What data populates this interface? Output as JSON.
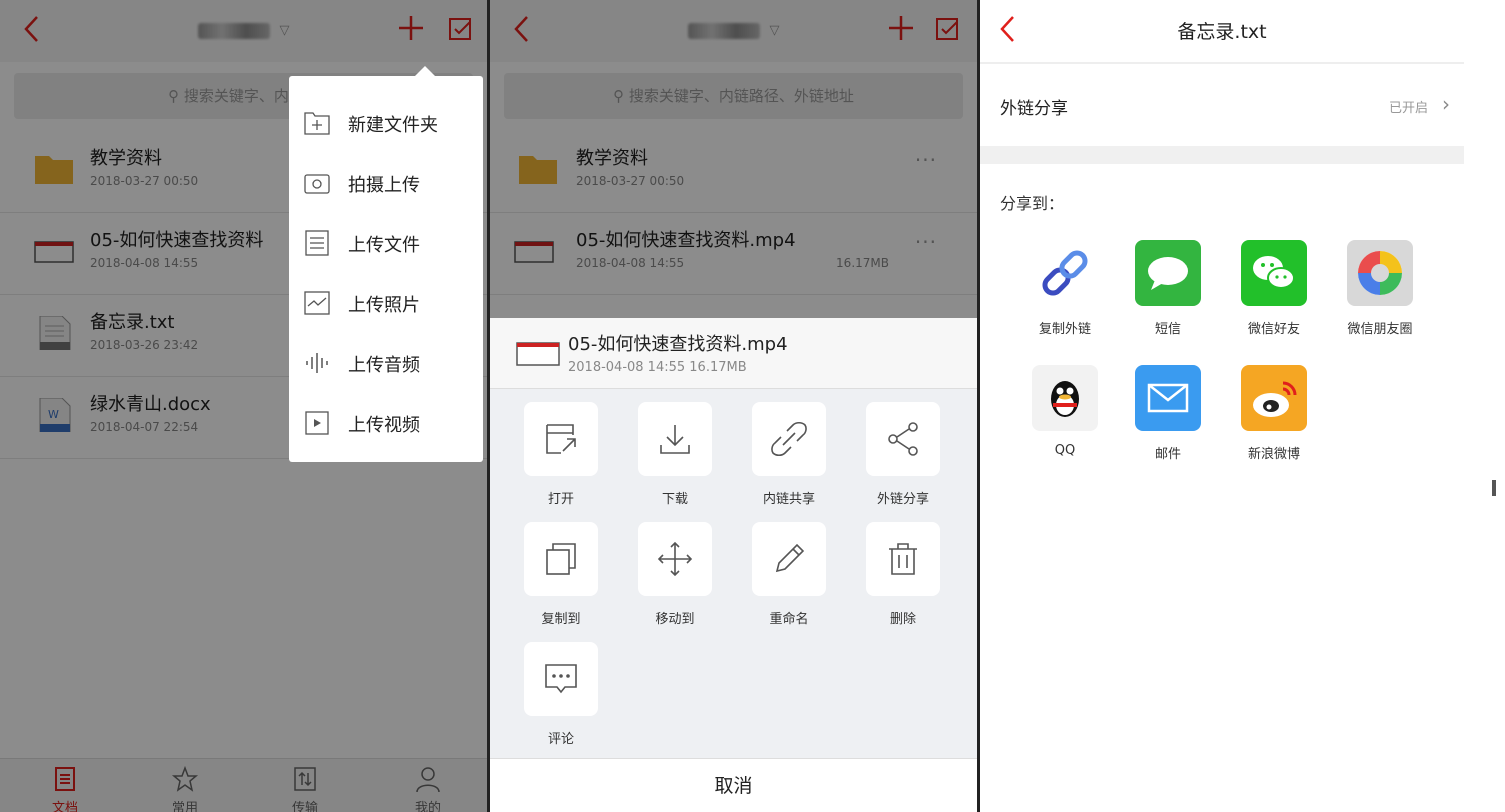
{
  "colors": {
    "accent": "#e0201c",
    "folder": "#f2b636",
    "wechat": "#22c02a",
    "sms": "#33b540",
    "mail": "#3a9bf0"
  },
  "panel1": {
    "search_placeholder": "搜索关键字、内链路",
    "files": [
      {
        "name": "教学资料",
        "meta": "2018-03-27 00:50",
        "icon": "folder-icon"
      },
      {
        "name": "05-如何快速查找资料",
        "meta": "2018-04-08 14:55",
        "icon": "video-file-icon"
      },
      {
        "name": "备忘录.txt",
        "meta": "2018-03-26 23:42",
        "icon": "txt-file-icon"
      },
      {
        "name": "绿水青山.docx",
        "meta": "2018-04-07 22:54",
        "icon": "word-file-icon"
      }
    ],
    "menu": [
      {
        "label": "新建文件夹",
        "icon": "new-folder-icon"
      },
      {
        "label": "拍摄上传",
        "icon": "camera-icon"
      },
      {
        "label": "上传文件",
        "icon": "document-icon"
      },
      {
        "label": "上传照片",
        "icon": "photo-icon"
      },
      {
        "label": "上传音频",
        "icon": "audio-icon"
      },
      {
        "label": "上传视频",
        "icon": "video-icon"
      }
    ],
    "tabs": [
      {
        "label": "文档",
        "icon": "document-tab-icon"
      },
      {
        "label": "常用",
        "icon": "star-icon"
      },
      {
        "label": "传输",
        "icon": "transfer-icon"
      },
      {
        "label": "我的",
        "icon": "person-icon"
      }
    ]
  },
  "panel2": {
    "search_placeholder": "搜索关键字、内链路径、外链地址",
    "files": [
      {
        "name": "教学资料",
        "meta": "2018-03-27 00:50"
      },
      {
        "name": "05-如何快速查找资料.mp4",
        "meta": "2018-04-08 14:55",
        "size": "16.17MB"
      }
    ],
    "sheet": {
      "file_name": "05-如何快速查找资料.mp4",
      "file_meta": "2018-04-08 14:55    16.17MB",
      "actions": [
        {
          "label": "打开",
          "icon": "open-icon"
        },
        {
          "label": "下载",
          "icon": "download-icon"
        },
        {
          "label": "内链共享",
          "icon": "link-icon"
        },
        {
          "label": "外链分享",
          "icon": "share-icon"
        },
        {
          "label": "复制到",
          "icon": "copy-icon"
        },
        {
          "label": "移动到",
          "icon": "move-icon"
        },
        {
          "label": "重命名",
          "icon": "rename-icon"
        },
        {
          "label": "删除",
          "icon": "delete-icon"
        },
        {
          "label": "评论",
          "icon": "comment-icon"
        }
      ],
      "cancel": "取消"
    }
  },
  "panel3": {
    "title": "备忘录.txt",
    "external_share_label": "外链分享",
    "external_share_status": "已开启",
    "share_to": "分享到：",
    "apps": [
      {
        "label": "复制外链",
        "icon": "chain-link-icon"
      },
      {
        "label": "短信",
        "icon": "sms-icon"
      },
      {
        "label": "微信好友",
        "icon": "wechat-icon"
      },
      {
        "label": "微信朋友圈",
        "icon": "moments-icon"
      },
      {
        "label": "QQ",
        "icon": "qq-icon"
      },
      {
        "label": "邮件",
        "icon": "mail-icon"
      },
      {
        "label": "新浪微博",
        "icon": "weibo-icon"
      }
    ]
  }
}
